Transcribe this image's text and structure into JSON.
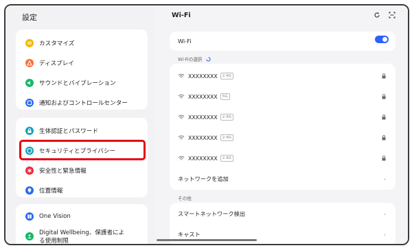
{
  "left": {
    "title": "設定",
    "card1": [
      {
        "label": "カスタマイズ",
        "icon": "palette-icon",
        "color": "#f5b800"
      },
      {
        "label": "ディスプレイ",
        "icon": "display-icon",
        "color": "#ff6d2d"
      },
      {
        "label": "サウンドとバイブレーション",
        "icon": "speaker-icon",
        "color": "#18b86b"
      },
      {
        "label": "通知およびコントロールセンター",
        "icon": "notification-icon",
        "color": "#2b6af0"
      }
    ],
    "card2": [
      {
        "label": "生体認証とパスワード",
        "icon": "lock-icon",
        "color": "#14a3b8"
      },
      {
        "label": "セキュリティとプライバシー",
        "icon": "shield-icon",
        "color": "#14a3b8"
      },
      {
        "label": "安全性と緊急情報",
        "icon": "asterisk-icon",
        "color": "#ef2b3c"
      },
      {
        "label": "位置情報",
        "icon": "location-pin-icon",
        "color": "#2b6af0"
      }
    ],
    "card3": [
      {
        "label": "One Vision",
        "icon": "one-vision-icon",
        "color": "#2b6af0"
      },
      {
        "label": "Digital Wellbeing、保護者による使用制限",
        "icon": "wellbeing-icon",
        "color": "#18b86b"
      }
    ]
  },
  "right": {
    "title": "Wi-Fi",
    "wifi_label": "Wi-Fi",
    "wifi_on": true,
    "select_label": "Wi-Fiの選択",
    "networks": [
      {
        "ssid": "XXXXXXXX",
        "band": "2.4G"
      },
      {
        "ssid": "XXXXXXXX",
        "band": "5G"
      },
      {
        "ssid": "XXXXXXXX",
        "band": "2.4G"
      },
      {
        "ssid": "XXXXXXXX",
        "band": "2.4G"
      },
      {
        "ssid": "XXXXXXXX",
        "band": "2.4G"
      }
    ],
    "add_network": "ネットワークを追加",
    "other_label": "その他",
    "smart_detect": "スマートネットワーク検出",
    "cast": "キャスト"
  },
  "colors": {
    "accent": "#2962ff",
    "highlight": "#e60012"
  }
}
